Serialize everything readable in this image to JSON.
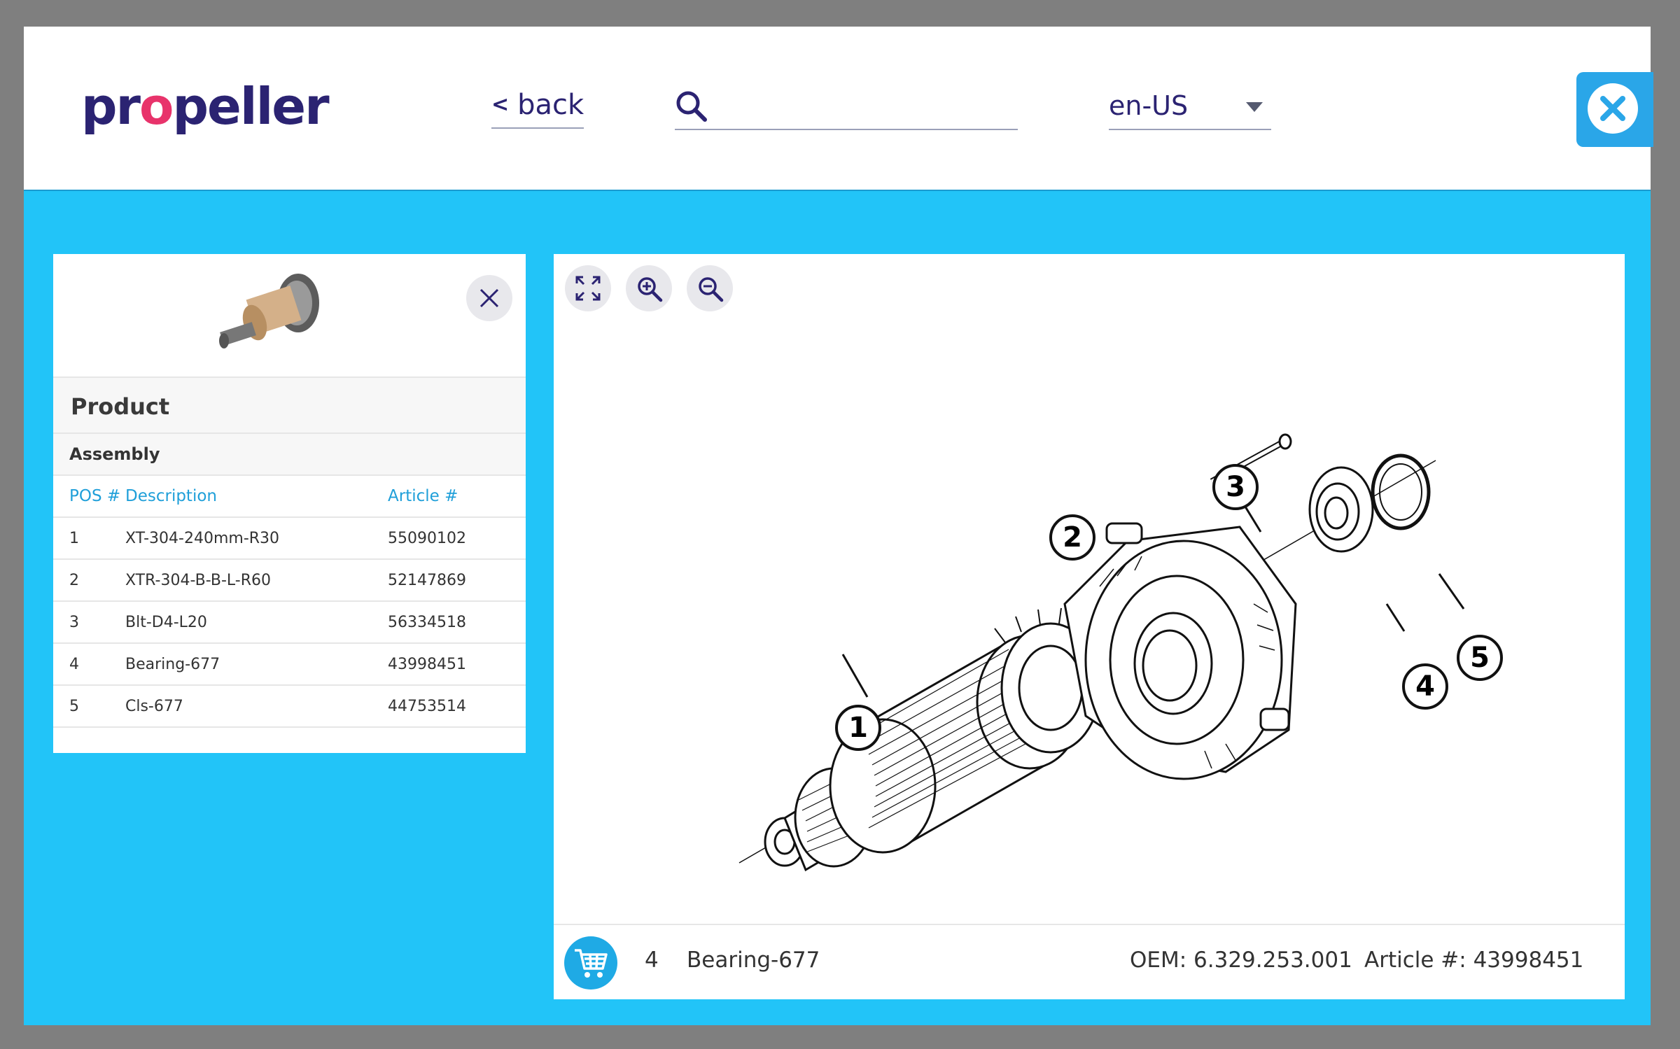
{
  "header": {
    "logo_text_1": "pr",
    "logo_text_o": "o",
    "logo_text_2": "peller",
    "back_label": "back",
    "search": {
      "value": "",
      "placeholder": ""
    },
    "language": "en-US"
  },
  "side_panel": {
    "title": "Product",
    "subtitle": "Assembly",
    "columns": [
      "POS #",
      "Description",
      "Article #"
    ],
    "rows": [
      {
        "pos": "1",
        "desc": "XT-304-240mm-R30",
        "article": "55090102"
      },
      {
        "pos": "2",
        "desc": "XTR-304-B-B-L-R60",
        "article": "52147869"
      },
      {
        "pos": "3",
        "desc": "Blt-D4-L20",
        "article": "56334518"
      },
      {
        "pos": "4",
        "desc": "Bearing-677",
        "article": "43998451"
      },
      {
        "pos": "5",
        "desc": "Cls-677",
        "article": "44753514"
      }
    ]
  },
  "diagram": {
    "callouts": [
      "1",
      "2",
      "3",
      "4",
      "5"
    ]
  },
  "selection": {
    "pos": "4",
    "name": "Bearing-677",
    "oem": "OEM: 6.329.253.001",
    "article": "Article #: 43998451"
  },
  "colors": {
    "accent": "#22c4f8",
    "brand": "#2b2372",
    "logo_highlight": "#e8336b",
    "link": "#1f9fd9"
  },
  "icons": [
    "back-chevron-icon",
    "search-icon",
    "dropdown-caret-icon",
    "close-icon",
    "fullscreen-icon",
    "zoom-in-icon",
    "zoom-out-icon",
    "cart-icon"
  ]
}
